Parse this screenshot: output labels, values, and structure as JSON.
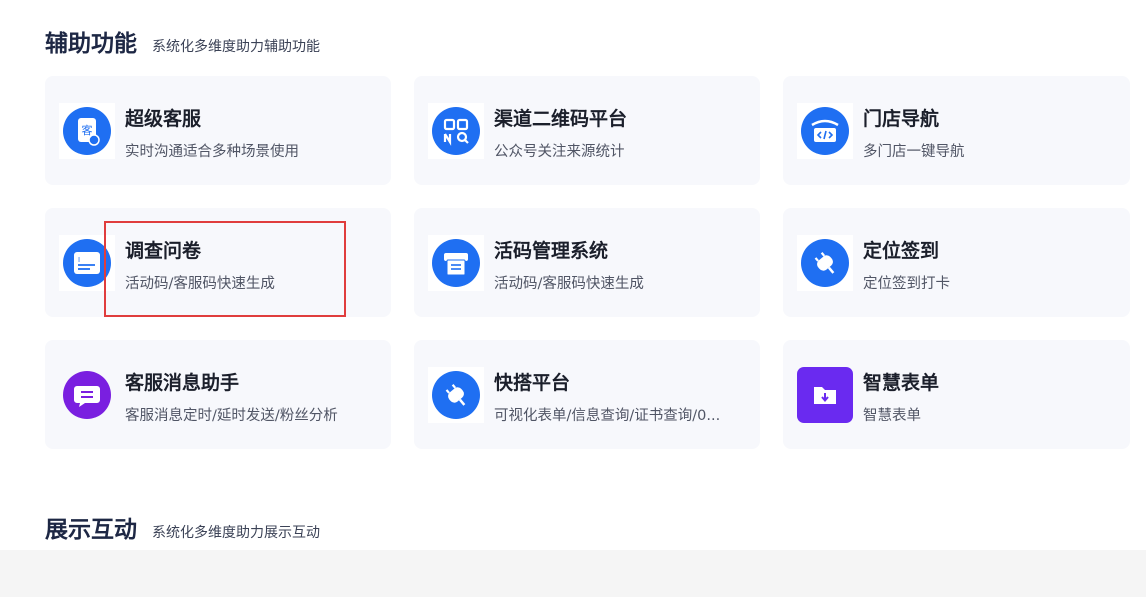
{
  "sections": [
    {
      "title": "辅助功能",
      "subtitle": "系统化多维度助力辅助功能"
    },
    {
      "title": "展示互动",
      "subtitle": "系统化多维度助力展示互动"
    }
  ],
  "cards": [
    {
      "title": "超级客服",
      "desc": "实时沟通适合多种场景使用",
      "icon": "customer-service-icon",
      "color": "#1f6ff2"
    },
    {
      "title": "渠道二维码平台",
      "desc": "公众号关注来源统计",
      "icon": "qr-code-icon",
      "color": "#1f6ff2"
    },
    {
      "title": "门店导航",
      "desc": "多门店一键导航",
      "icon": "store-navigation-icon",
      "color": "#1f6ff2"
    },
    {
      "title": "调查问卷",
      "desc": "活动码/客服码快速生成",
      "icon": "survey-icon",
      "color": "#1f6ff2"
    },
    {
      "title": "活码管理系统",
      "desc": "活动码/客服码快速生成",
      "icon": "live-code-icon",
      "color": "#1f6ff2"
    },
    {
      "title": "定位签到",
      "desc": "定位签到打卡",
      "icon": "location-checkin-icon",
      "color": "#1f6ff2"
    },
    {
      "title": "客服消息助手",
      "desc": "客服消息定时/延时发送/粉丝分析",
      "icon": "message-assistant-icon",
      "color": "#7a1fe0"
    },
    {
      "title": "快搭平台",
      "desc": "可视化表单/信息查询/证书查询/0...",
      "icon": "quick-build-icon",
      "color": "#1f6ff2"
    },
    {
      "title": "智慧表单",
      "desc": "智慧表单",
      "icon": "smart-form-icon",
      "color": "#6a2af0"
    }
  ]
}
